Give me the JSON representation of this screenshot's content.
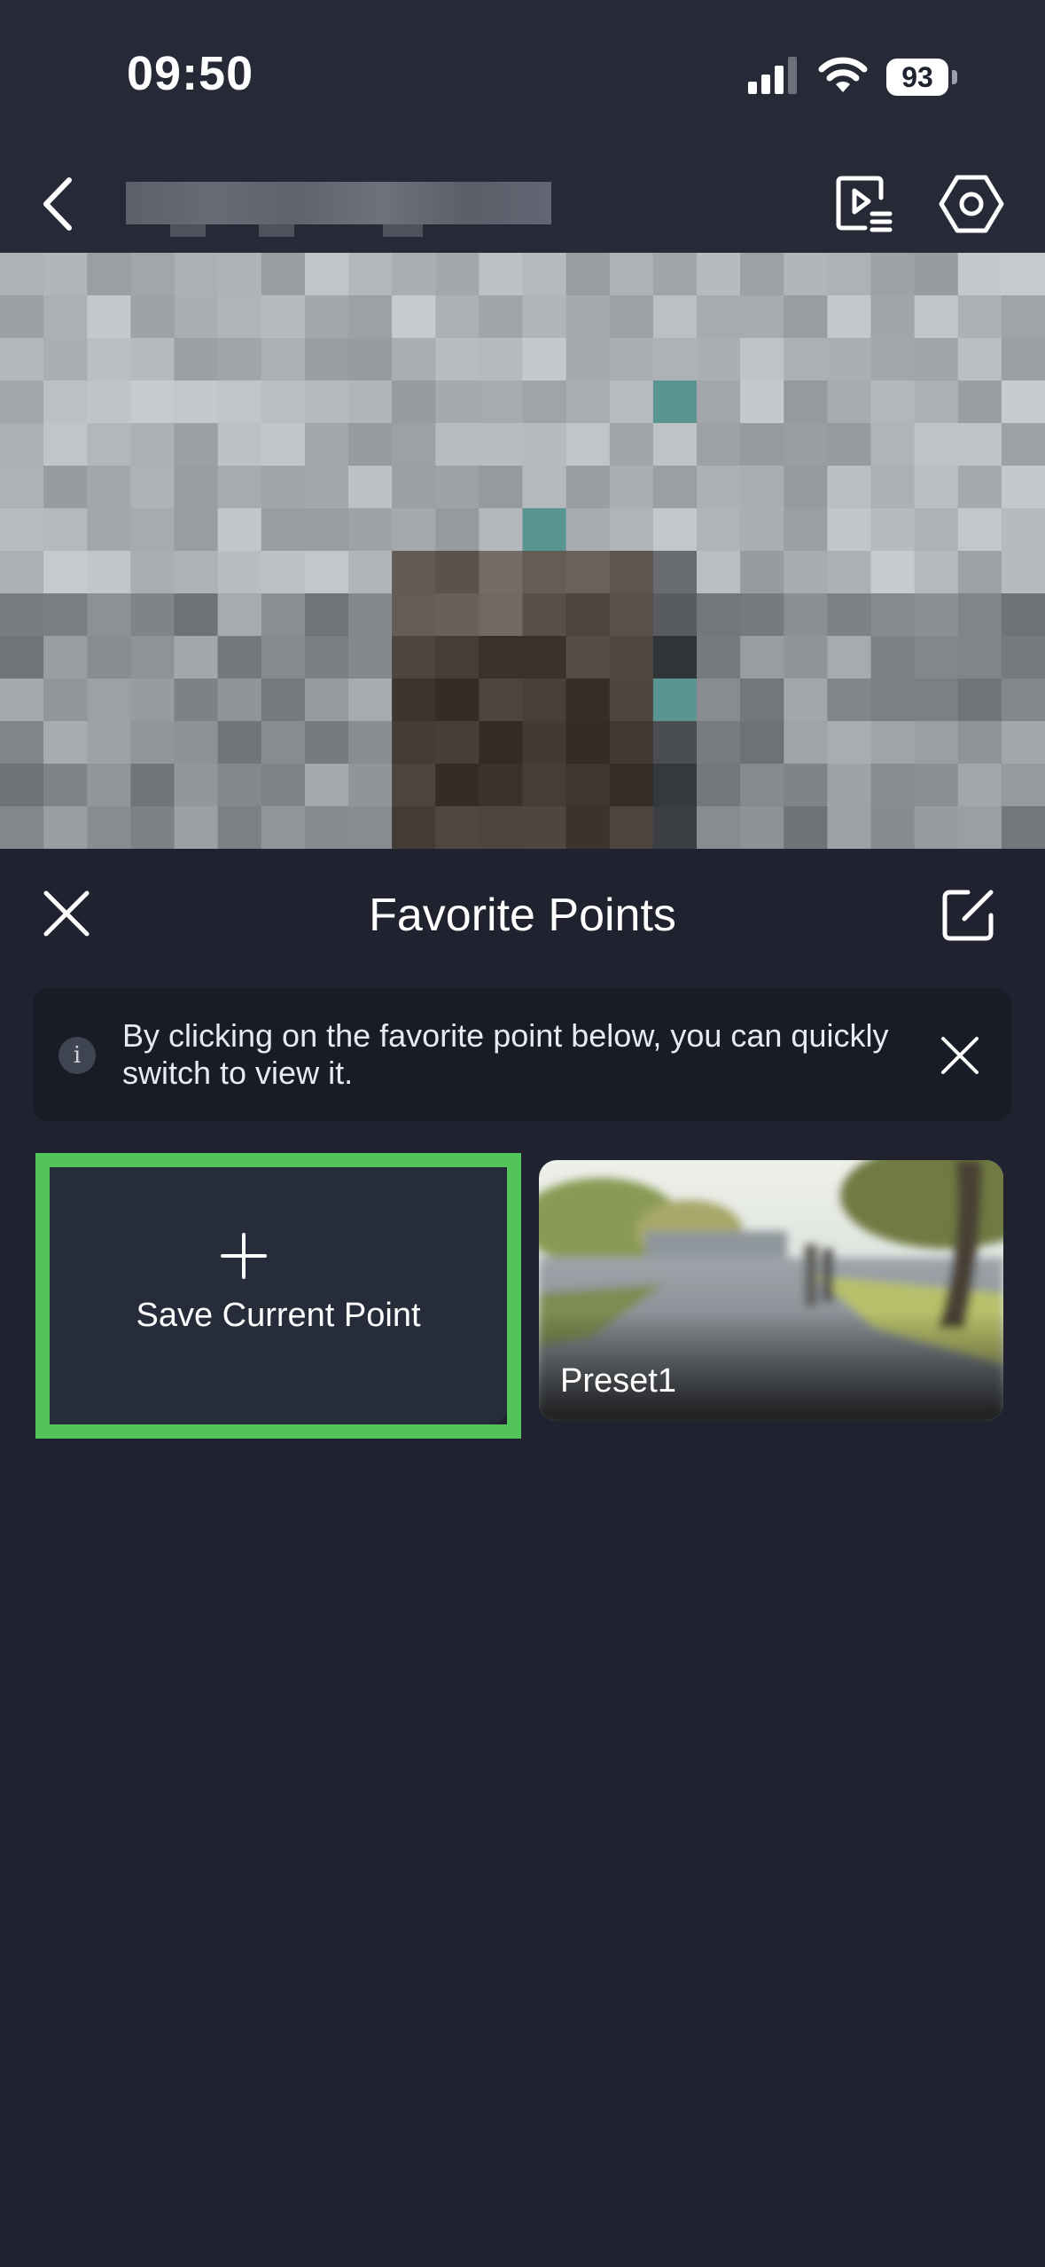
{
  "status_bar": {
    "time": "09:50",
    "battery": "93"
  },
  "nav": {
    "back_icon": "chevron-left-icon",
    "playback_icon": "playback-list-icon",
    "settings_icon": "gear-hexagon-icon"
  },
  "sheet": {
    "title": "Favorite Points",
    "close_icon": "close-icon",
    "edit_icon": "edit-icon"
  },
  "notice": {
    "text": "By clicking on the favorite point below, you can quickly switch to view it.",
    "info_icon": "info-icon"
  },
  "favorites": {
    "add_label": "Save Current Point",
    "presets": [
      {
        "label": "Preset1"
      }
    ]
  },
  "colors": {
    "background": "#20232f",
    "highlight": "#52c458",
    "card": "#262c39",
    "notice_bg": "#181c26"
  }
}
